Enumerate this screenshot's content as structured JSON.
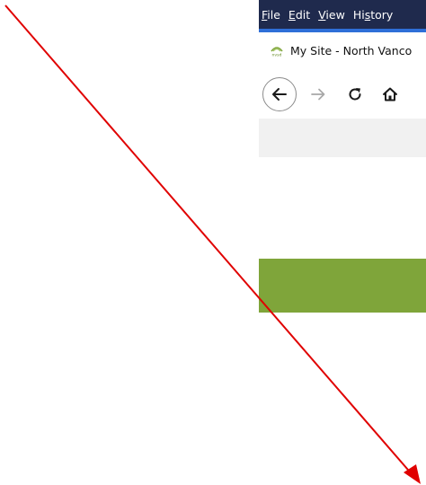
{
  "menubar": {
    "items": [
      {
        "key": "F",
        "rest": "ile"
      },
      {
        "key": "E",
        "rest": "dit"
      },
      {
        "key": "V",
        "rest": "iew"
      },
      {
        "pre": "Hi",
        "key": "s",
        "rest": "tory"
      }
    ]
  },
  "tab": {
    "title": "My Site - North Vanco",
    "favicon_text": "nvsd"
  },
  "colors": {
    "menubar": "#1f2a4d",
    "accent": "#2f6fd8",
    "green_banner": "#7fa53a",
    "annotation_arrow": "#e00000"
  },
  "icons": {
    "back": "back-arrow-icon",
    "forward": "forward-arrow-icon",
    "reload": "reload-icon",
    "home": "home-icon"
  }
}
